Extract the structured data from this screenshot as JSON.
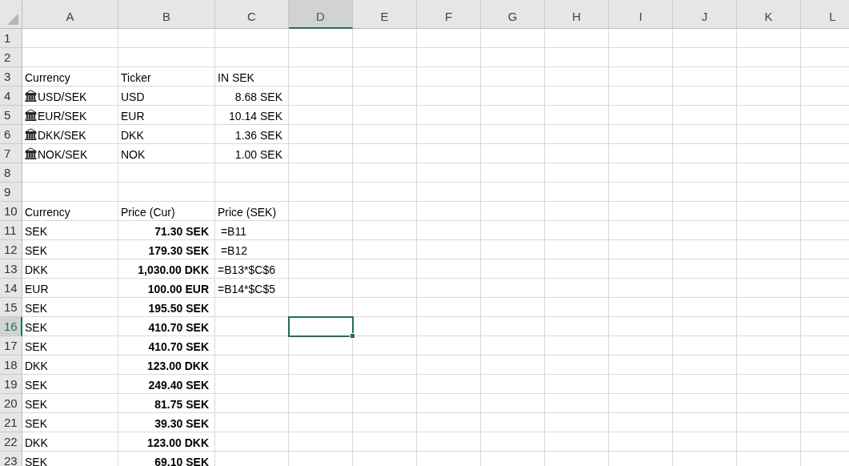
{
  "columns": [
    {
      "label": "A",
      "selected": false
    },
    {
      "label": "B",
      "selected": false
    },
    {
      "label": "C",
      "selected": false
    },
    {
      "label": "D",
      "selected": true
    },
    {
      "label": "E",
      "selected": false
    },
    {
      "label": "F",
      "selected": false
    },
    {
      "label": "G",
      "selected": false
    },
    {
      "label": "H",
      "selected": false
    },
    {
      "label": "I",
      "selected": false
    },
    {
      "label": "J",
      "selected": false
    },
    {
      "label": "K",
      "selected": false
    },
    {
      "label": "L",
      "selected": false
    }
  ],
  "rows": [
    {
      "number": "1",
      "selected": false,
      "cells": {}
    },
    {
      "number": "2",
      "selected": false,
      "cells": {}
    },
    {
      "number": "3",
      "selected": false,
      "cells": {
        "a": {
          "text": "Currency",
          "kind": "label"
        },
        "b": {
          "text": "Ticker",
          "kind": "label"
        },
        "c": {
          "text": "IN SEK",
          "kind": "label"
        }
      }
    },
    {
      "number": "4",
      "selected": false,
      "cells": {
        "a": {
          "text": "USD/SEK",
          "kind": "stock"
        },
        "b": {
          "text": "USD",
          "kind": "label"
        },
        "c": {
          "text": "8.68 SEK",
          "kind": "number"
        }
      }
    },
    {
      "number": "5",
      "selected": false,
      "cells": {
        "a": {
          "text": "EUR/SEK",
          "kind": "stock"
        },
        "b": {
          "text": "EUR",
          "kind": "label"
        },
        "c": {
          "text": "10.14 SEK",
          "kind": "number"
        }
      }
    },
    {
      "number": "6",
      "selected": false,
      "cells": {
        "a": {
          "text": "DKK/SEK",
          "kind": "stock"
        },
        "b": {
          "text": "DKK",
          "kind": "label"
        },
        "c": {
          "text": "1.36 SEK",
          "kind": "number"
        }
      }
    },
    {
      "number": "7",
      "selected": false,
      "cells": {
        "a": {
          "text": "NOK/SEK",
          "kind": "stock"
        },
        "b": {
          "text": "NOK",
          "kind": "label"
        },
        "c": {
          "text": "1.00 SEK",
          "kind": "number"
        }
      }
    },
    {
      "number": "8",
      "selected": false,
      "cells": {}
    },
    {
      "number": "9",
      "selected": false,
      "cells": {}
    },
    {
      "number": "10",
      "selected": false,
      "cells": {
        "a": {
          "text": "Currency",
          "kind": "label"
        },
        "b": {
          "text": "Price (Cur)",
          "kind": "label"
        },
        "c": {
          "text": "Price (SEK)",
          "kind": "label"
        }
      }
    },
    {
      "number": "11",
      "selected": false,
      "cells": {
        "a": {
          "text": "SEK",
          "kind": "label"
        },
        "b": {
          "text": "71.30 SEK",
          "kind": "bold_number"
        },
        "c": {
          "text": " =B11",
          "kind": "label"
        }
      }
    },
    {
      "number": "12",
      "selected": false,
      "cells": {
        "a": {
          "text": "SEK",
          "kind": "label"
        },
        "b": {
          "text": "179.30 SEK",
          "kind": "bold_number"
        },
        "c": {
          "text": " =B12",
          "kind": "label"
        }
      }
    },
    {
      "number": "13",
      "selected": false,
      "cells": {
        "a": {
          "text": "DKK",
          "kind": "label"
        },
        "b": {
          "text": "1,030.00 DKK",
          "kind": "bold_number"
        },
        "c": {
          "text": "=B13*$C$6",
          "kind": "label"
        }
      }
    },
    {
      "number": "14",
      "selected": false,
      "cells": {
        "a": {
          "text": "EUR",
          "kind": "label"
        },
        "b": {
          "text": "100.00 EUR",
          "kind": "bold_number"
        },
        "c": {
          "text": "=B14*$C$5",
          "kind": "label"
        }
      }
    },
    {
      "number": "15",
      "selected": false,
      "cells": {
        "a": {
          "text": "SEK",
          "kind": "label"
        },
        "b": {
          "text": "195.50 SEK",
          "kind": "bold_number"
        }
      }
    },
    {
      "number": "16",
      "selected": true,
      "cells": {
        "a": {
          "text": "SEK",
          "kind": "label"
        },
        "b": {
          "text": "410.70 SEK",
          "kind": "bold_number"
        }
      }
    },
    {
      "number": "17",
      "selected": false,
      "cells": {
        "a": {
          "text": "SEK",
          "kind": "label"
        },
        "b": {
          "text": "410.70 SEK",
          "kind": "bold_number"
        }
      }
    },
    {
      "number": "18",
      "selected": false,
      "cells": {
        "a": {
          "text": "DKK",
          "kind": "label"
        },
        "b": {
          "text": "123.00 DKK",
          "kind": "bold_number"
        }
      }
    },
    {
      "number": "19",
      "selected": false,
      "cells": {
        "a": {
          "text": "SEK",
          "kind": "label"
        },
        "b": {
          "text": "249.40 SEK",
          "kind": "bold_number"
        }
      }
    },
    {
      "number": "20",
      "selected": false,
      "cells": {
        "a": {
          "text": "SEK",
          "kind": "label"
        },
        "b": {
          "text": "81.75 SEK",
          "kind": "bold_number"
        }
      }
    },
    {
      "number": "21",
      "selected": false,
      "cells": {
        "a": {
          "text": "SEK",
          "kind": "label"
        },
        "b": {
          "text": "39.30 SEK",
          "kind": "bold_number"
        }
      }
    },
    {
      "number": "22",
      "selected": false,
      "cells": {
        "a": {
          "text": "DKK",
          "kind": "label"
        },
        "b": {
          "text": "123.00 DKK",
          "kind": "bold_number"
        }
      }
    },
    {
      "number": "23",
      "selected": false,
      "cells": {
        "a": {
          "text": "SEK",
          "kind": "label"
        },
        "b": {
          "text": "69.10 SEK",
          "kind": "bold_number"
        }
      }
    }
  ]
}
